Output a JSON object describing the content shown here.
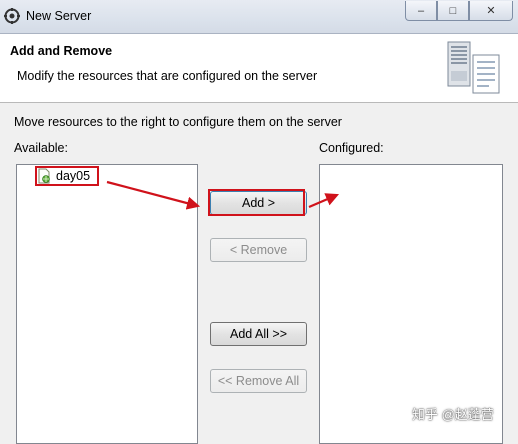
{
  "window": {
    "title": "New Server",
    "icon": "eclipse-gear-icon",
    "controls": {
      "minimize": "–",
      "maximize": "□",
      "close": "✕"
    }
  },
  "header": {
    "title": "Add and Remove",
    "description": "Modify the resources that are configured on the server",
    "image": "server-icon"
  },
  "body": {
    "instruction": "Move resources to the right to configure them on the server",
    "available_label": "Available:",
    "configured_label": "Configured:",
    "available_items": [
      {
        "label": "day05",
        "icon": "web-project-icon"
      }
    ],
    "configured_items": []
  },
  "buttons": {
    "add": "Add >",
    "remove": "< Remove",
    "add_all": "Add All >>",
    "remove_all": "<< Remove All"
  },
  "colors": {
    "annotation_red": "#d0121b"
  },
  "watermark": "知乎 @赵蓬营"
}
